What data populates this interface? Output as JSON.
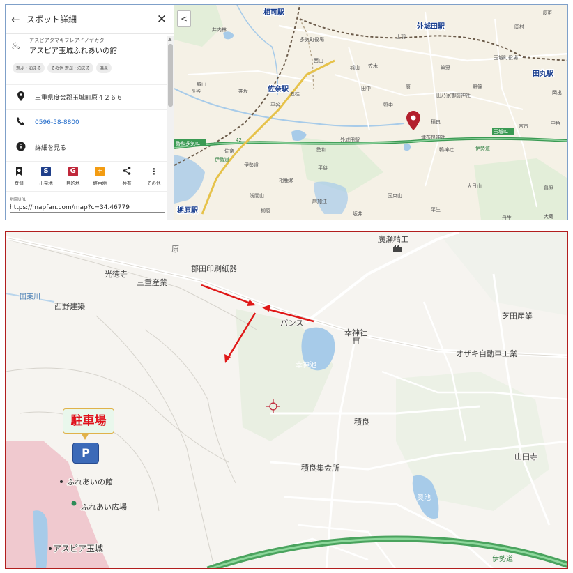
{
  "sidebar": {
    "back_icon": "arrow-left-icon",
    "title": "スポット詳細",
    "close_icon": "close-icon",
    "poi": {
      "icon": "hot-spring-icon",
      "kana": "アスピアタマキフレアイノヤカタ",
      "name": "アスピア玉城ふれあいの館",
      "tags": [
        "遊ぶ・泊まる",
        "その他 遊ぶ・泊まる",
        "温泉"
      ]
    },
    "address": {
      "icon": "location-pin-icon",
      "text": "三重県度会郡玉城町原４２６６"
    },
    "phone": {
      "icon": "phone-icon",
      "text": "0596-58-8800"
    },
    "details": {
      "icon": "info-icon",
      "text": "詳細を見る"
    },
    "actions": [
      {
        "label": "登録",
        "icon": "bookmark-icon",
        "symbol": "🔖",
        "color": "#333333"
      },
      {
        "label": "出発地",
        "icon": "start-point-icon",
        "symbol": "S",
        "color": "#1f3f8a"
      },
      {
        "label": "目的地",
        "icon": "goal-point-icon",
        "symbol": "G",
        "color": "#c0283b"
      },
      {
        "label": "経由地",
        "icon": "waypoint-icon",
        "symbol": "+",
        "color": "#f39c12"
      },
      {
        "label": "共有",
        "icon": "share-icon",
        "symbol": "<",
        "color": "#333333"
      },
      {
        "label": "その他",
        "icon": "more-icon",
        "symbol": "⋮",
        "color": "#333333"
      }
    ],
    "url_label": "地図URL",
    "url_value": "https://mapfan.com/map?c=34.46779"
  },
  "map_top": {
    "collapse_icon": "chevron-left-icon",
    "collapse_symbol": "<",
    "stations": [
      "相可駅",
      "外城田駅",
      "田丸駅",
      "佐奈駅",
      "栃原駅"
    ],
    "ic_labels": [
      "勢和多気IC",
      "玉城IC"
    ],
    "road_labels": [
      "伊勢道",
      "42",
      "伊勢道"
    ],
    "labels": [
      "井内林",
      "多気町役場",
      "西山",
      "城山",
      "笠木",
      "土羽",
      "岡村",
      "長更",
      "玉城町役場",
      "蚊野",
      "野篠",
      "田乃家御前神社",
      "岡出",
      "城山",
      "長谷",
      "神坂",
      "五桂",
      "平谷",
      "田中",
      "野中",
      "原",
      "積良",
      "宮古",
      "中角",
      "津布良神社",
      "鴨神社",
      "伊勢道",
      "佐奈",
      "外城田駅",
      "勢和",
      "平谷",
      "相鹿瀬",
      "浅間山",
      "麻加江",
      "国束山",
      "大日山",
      "菖原",
      "柳原",
      "坂井",
      "平生",
      "大蔵",
      "丹生"
    ],
    "colors": {
      "highway": "#3a9a53",
      "rail": "#6b5b4a",
      "water": "#a7cbe9",
      "pin": "#b3202d"
    }
  },
  "map_bottom": {
    "labels": {
      "hara": "原",
      "koutokuji": "光徳寺",
      "mie_sangyo": "三重産業",
      "gouda_print": "郡田印刷紙器",
      "hirose_seiko": "廣瀬精工",
      "kunitsuka_river": "国束川",
      "nishino_kenchiku": "西野建築",
      "pansu": "パンス",
      "koujinja": "幸神社",
      "shibata_sangyo": "芝田産業",
      "ozaki": "オザキ自動車工業",
      "koujin_pond": "幸神池",
      "sekira": "積良",
      "sekira_hall": "積良集会所",
      "yamadadera": "山田寺",
      "oku_pond": "奥池",
      "ise_road": "伊勢道",
      "fureai_hall": "ふれあいの館",
      "fureai_plaza": "ふれあい広場",
      "aspia": "アスピア玉城"
    },
    "parking_label": "駐車場",
    "parking_symbol": "P",
    "colors": {
      "arrow": "#e01818",
      "parking_text": "#e0101a",
      "parking_box": "#e9f7ec",
      "parking_badge": "#3c6ab8",
      "facility_area": "#f0c9cf",
      "water": "#a7cbe9",
      "highway": "#4aa35e"
    }
  }
}
